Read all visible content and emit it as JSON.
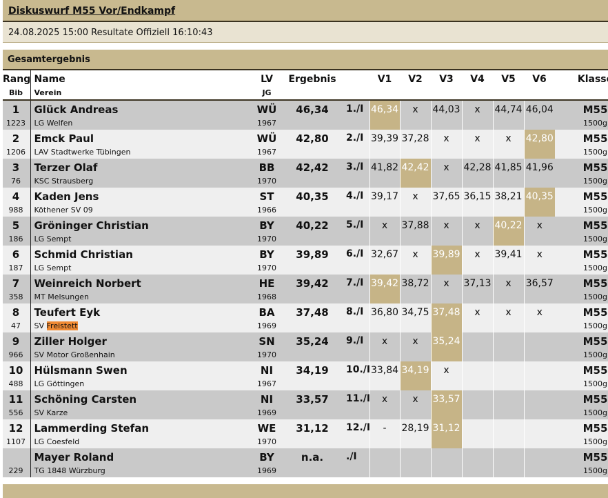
{
  "header": {
    "title": "Diskuswurf M55 Vor/Endkampf",
    "subtitle": "24.08.2025 15:00 Resultate Offiziell 16:10:43",
    "section": "Gesamtergebnis"
  },
  "columns": {
    "rang": "Rang",
    "bib": "Bib",
    "name": "Name",
    "verein": "Verein",
    "lv": "LV",
    "jg": "JG",
    "ergebnis": "Ergebnis",
    "v1": "V1",
    "v2": "V2",
    "v3": "V3",
    "v4": "V4",
    "v5": "V5",
    "v6": "V6",
    "klasse": "Klasse"
  },
  "rows": [
    {
      "rang": "1",
      "bib": "1223",
      "name": "Glück Andreas",
      "club": "LG Welfen",
      "lv": "WÜ",
      "jg": "1967",
      "result": "46,34",
      "place": "1./I",
      "attempts": [
        "46,34",
        "x",
        "44,03",
        "x",
        "44,74",
        "46,04"
      ],
      "best": 0,
      "klasse": "M55",
      "weight": "1500g"
    },
    {
      "rang": "2",
      "bib": "1206",
      "name": "Emck Paul",
      "club": "LAV Stadtwerke Tübingen",
      "lv": "WÜ",
      "jg": "1967",
      "result": "42,80",
      "place": "2./I",
      "attempts": [
        "39,39",
        "37,28",
        "x",
        "x",
        "x",
        "42,80"
      ],
      "best": 5,
      "klasse": "M55",
      "weight": "1500g"
    },
    {
      "rang": "3",
      "bib": "76",
      "name": "Terzer Olaf",
      "club": "KSC Strausberg",
      "lv": "BB",
      "jg": "1970",
      "result": "42,42",
      "place": "3./I",
      "attempts": [
        "41,82",
        "42,42",
        "x",
        "42,28",
        "41,85",
        "41,96"
      ],
      "best": 1,
      "klasse": "M55",
      "weight": "1500g"
    },
    {
      "rang": "4",
      "bib": "988",
      "name": "Kaden Jens",
      "club": "Köthener SV 09",
      "lv": "ST",
      "jg": "1966",
      "result": "40,35",
      "place": "4./I",
      "attempts": [
        "39,17",
        "x",
        "37,65",
        "36,15",
        "38,21",
        "40,35"
      ],
      "best": 5,
      "klasse": "M55",
      "weight": "1500g"
    },
    {
      "rang": "5",
      "bib": "186",
      "name": "Gröninger Christian",
      "club": "LG Sempt",
      "lv": "BY",
      "jg": "1970",
      "result": "40,22",
      "place": "5./I",
      "attempts": [
        "x",
        "37,88",
        "x",
        "x",
        "40,22",
        "x"
      ],
      "best": 4,
      "klasse": "M55",
      "weight": "1500g"
    },
    {
      "rang": "6",
      "bib": "187",
      "name": "Schmid Christian",
      "club": "LG Sempt",
      "lv": "BY",
      "jg": "1970",
      "result": "39,89",
      "place": "6./I",
      "attempts": [
        "32,67",
        "x",
        "39,89",
        "x",
        "39,41",
        "x"
      ],
      "best": 2,
      "klasse": "M55",
      "weight": "1500g"
    },
    {
      "rang": "7",
      "bib": "358",
      "name": "Weinreich Norbert",
      "club": "MT Melsungen",
      "lv": "HE",
      "jg": "1968",
      "result": "39,42",
      "place": "7./I",
      "attempts": [
        "39,42",
        "38,72",
        "x",
        "37,13",
        "x",
        "36,57"
      ],
      "best": 0,
      "klasse": "M55",
      "weight": "1500g"
    },
    {
      "rang": "8",
      "bib": "47",
      "name": "Teufert Eyk",
      "club_prefix": "SV ",
      "club_highlight": "Freistett",
      "lv": "BA",
      "jg": "1969",
      "result": "37,48",
      "place": "8./I",
      "attempts": [
        "36,80",
        "34,75",
        "37,48",
        "x",
        "x",
        "x"
      ],
      "best": 2,
      "klasse": "M55",
      "weight": "1500g"
    },
    {
      "rang": "9",
      "bib": "966",
      "name": "Ziller Holger",
      "club": "SV Motor Großenhain",
      "lv": "SN",
      "jg": "1970",
      "result": "35,24",
      "place": "9./I",
      "attempts": [
        "x",
        "x",
        "35,24",
        "",
        "",
        ""
      ],
      "best": 2,
      "klasse": "M55",
      "weight": "1500g"
    },
    {
      "rang": "10",
      "bib": "488",
      "name": "Hülsmann Swen",
      "club": "LG Göttingen",
      "lv": "NI",
      "jg": "1967",
      "result": "34,19",
      "place": "10./I",
      "attempts": [
        "33,84",
        "34,19",
        "x",
        "",
        "",
        ""
      ],
      "best": 1,
      "klasse": "M55",
      "weight": "1500g"
    },
    {
      "rang": "11",
      "bib": "556",
      "name": "Schöning Carsten",
      "club": "SV Karze",
      "lv": "NI",
      "jg": "1969",
      "result": "33,57",
      "place": "11./I",
      "attempts": [
        "x",
        "x",
        "33,57",
        "",
        "",
        ""
      ],
      "best": 2,
      "klasse": "M55",
      "weight": "1500g"
    },
    {
      "rang": "12",
      "bib": "1107",
      "name": "Lammerding Stefan",
      "club": "LG Coesfeld",
      "lv": "WE",
      "jg": "1970",
      "result": "31,12",
      "place": "12./I",
      "attempts": [
        "-",
        "28,19",
        "31,12",
        "",
        "",
        ""
      ],
      "best": 2,
      "klasse": "M55",
      "weight": "1500g"
    },
    {
      "rang": "",
      "bib": "229",
      "name": "Mayer Roland",
      "club": "TG 1848 Würzburg",
      "lv": "BY",
      "jg": "1969",
      "result": "n.a.",
      "place": "./I",
      "attempts": [
        "",
        "",
        "",
        "",
        "",
        ""
      ],
      "best": -1,
      "klasse": "M55",
      "weight": "1500g"
    }
  ]
}
